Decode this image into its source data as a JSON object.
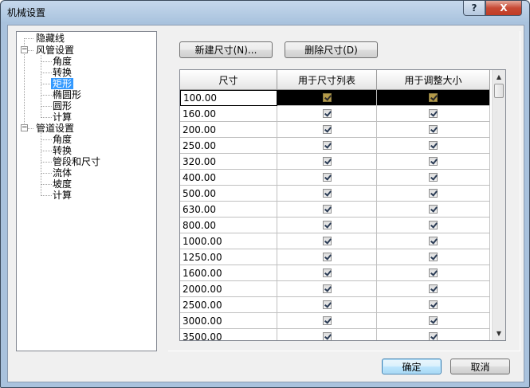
{
  "window": {
    "title": "机械设置",
    "help_label": "?",
    "close_label": "X"
  },
  "tree": {
    "items": [
      {
        "label": "隐藏线"
      },
      {
        "label": "风管设置",
        "expander": "−"
      },
      {
        "label": "角度"
      },
      {
        "label": "转换"
      },
      {
        "label": "矩形"
      },
      {
        "label": "椭圆形"
      },
      {
        "label": "圆形"
      },
      {
        "label": "计算"
      },
      {
        "label": "管道设置",
        "expander": "−"
      },
      {
        "label": "角度"
      },
      {
        "label": "转换"
      },
      {
        "label": "管段和尺寸"
      },
      {
        "label": "流体"
      },
      {
        "label": "坡度"
      },
      {
        "label": "计算"
      }
    ]
  },
  "toolbar": {
    "new_label": "新建尺寸(N)...",
    "delete_label": "删除尺寸(D)"
  },
  "grid": {
    "headers": [
      "尺寸",
      "用于尺寸列表",
      "用于调整大小"
    ],
    "rows": [
      {
        "size": "100.00"
      },
      {
        "size": "160.00"
      },
      {
        "size": "200.00"
      },
      {
        "size": "250.00"
      },
      {
        "size": "320.00"
      },
      {
        "size": "400.00"
      },
      {
        "size": "500.00"
      },
      {
        "size": "630.00"
      },
      {
        "size": "800.00"
      },
      {
        "size": "1000.00"
      },
      {
        "size": "1250.00"
      },
      {
        "size": "1600.00"
      },
      {
        "size": "2000.00"
      },
      {
        "size": "2500.00"
      },
      {
        "size": "3000.00"
      },
      {
        "size": "3500.00"
      }
    ]
  },
  "footer": {
    "ok_label": "确定",
    "cancel_label": "取消"
  }
}
